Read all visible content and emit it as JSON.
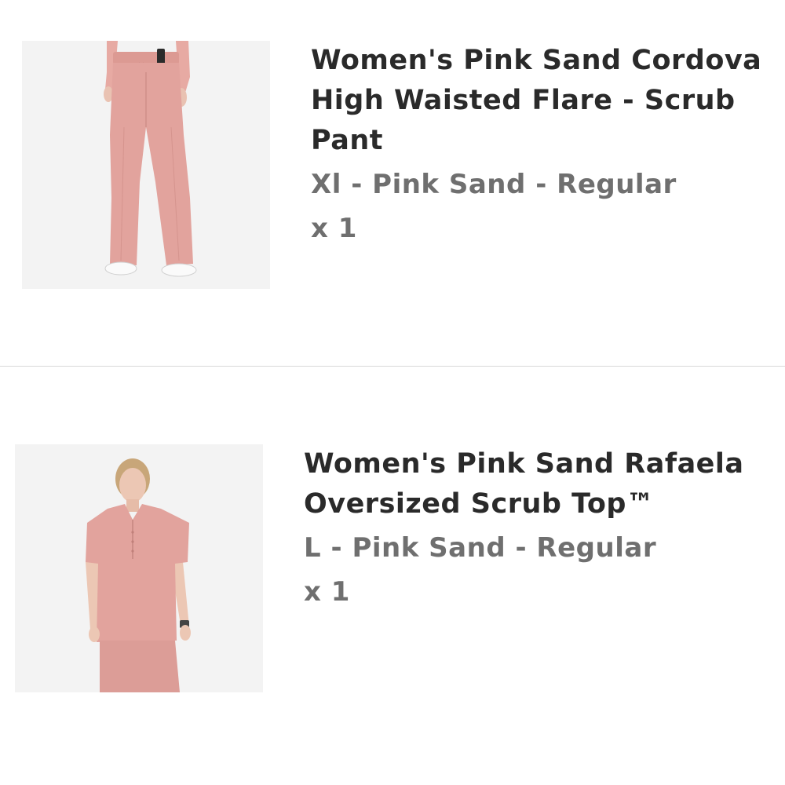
{
  "cart": {
    "items": [
      {
        "title_lines": [
          "Women's Pink Sand Cordova",
          "High Waisted Flare - Scrub",
          "Pant"
        ],
        "variant": "Xl - Pink Sand - Regular",
        "quantity": "x 1",
        "image_icon": "pant-product-image"
      },
      {
        "title_lines": [
          "Women's Pink Sand Rafaela",
          "Oversized Scrub Top™"
        ],
        "variant": "L - Pink Sand - Regular",
        "quantity": "x 1",
        "image_icon": "top-product-image"
      }
    ]
  },
  "colors": {
    "product_pink": "#e2a39d",
    "title_text": "#2a2a2a",
    "subtext": "#6f6f6f",
    "divider": "#d8d8d8",
    "image_bg": "#f3f3f3"
  }
}
